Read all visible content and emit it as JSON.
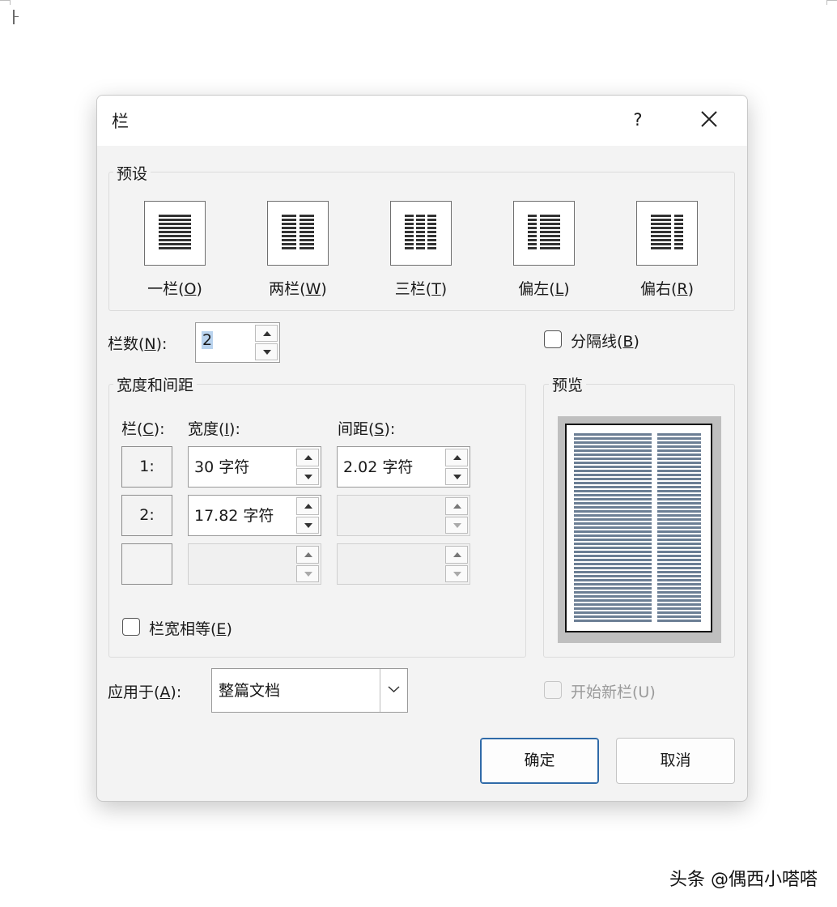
{
  "dialog": {
    "title": "栏",
    "help_label": "?",
    "close_icon": "close-icon"
  },
  "presets": {
    "group_label": "预设",
    "items": [
      {
        "label": "一栏(",
        "key": "O",
        "label_end": ")",
        "icon": "one-column-icon"
      },
      {
        "label": "两栏(",
        "key": "W",
        "label_end": ")",
        "icon": "two-columns-icon"
      },
      {
        "label": "三栏(",
        "key": "T",
        "label_end": ")",
        "icon": "three-columns-icon"
      },
      {
        "label": "偏左(",
        "key": "L",
        "label_end": ")",
        "icon": "left-column-icon"
      },
      {
        "label": "偏右(",
        "key": "R",
        "label_end": ")",
        "icon": "right-column-icon"
      }
    ]
  },
  "columns_count": {
    "label": "栏数(",
    "key": "N",
    "label_end": "):",
    "value": "2"
  },
  "separator": {
    "label": "分隔线(",
    "key": "B",
    "label_end": ")",
    "checked": false
  },
  "width_spacing": {
    "group_label": "宽度和间距",
    "col_header": "栏(",
    "col_key": "C",
    "col_header_end": "):",
    "width_header": "宽度(",
    "width_key": "I",
    "width_header_end": "):",
    "spacing_header": "间距(",
    "spacing_key": "S",
    "spacing_header_end": "):",
    "rows": [
      {
        "col": "1:",
        "width": "30 字符",
        "spacing": "2.02 字符"
      },
      {
        "col": "2:",
        "width": "17.82 字符",
        "spacing": ""
      },
      {
        "col": "",
        "width": "",
        "spacing": ""
      }
    ],
    "equal_width": {
      "label": "栏宽相等(",
      "key": "E",
      "label_end": ")",
      "checked": false
    }
  },
  "preview": {
    "group_label": "预览"
  },
  "apply_to": {
    "label": "应用于(",
    "key": "A",
    "label_end": "):",
    "value": "整篇文档"
  },
  "new_column": {
    "label": "开始新栏(U)",
    "checked": false,
    "disabled": true
  },
  "buttons": {
    "ok": "确定",
    "cancel": "取消"
  },
  "watermark": "头条 @偶西小嗒嗒",
  "colors": {
    "accent": "#2f6aa8",
    "preview_lines": "#6b7e94",
    "dialog_bg": "#f3f3f3"
  }
}
